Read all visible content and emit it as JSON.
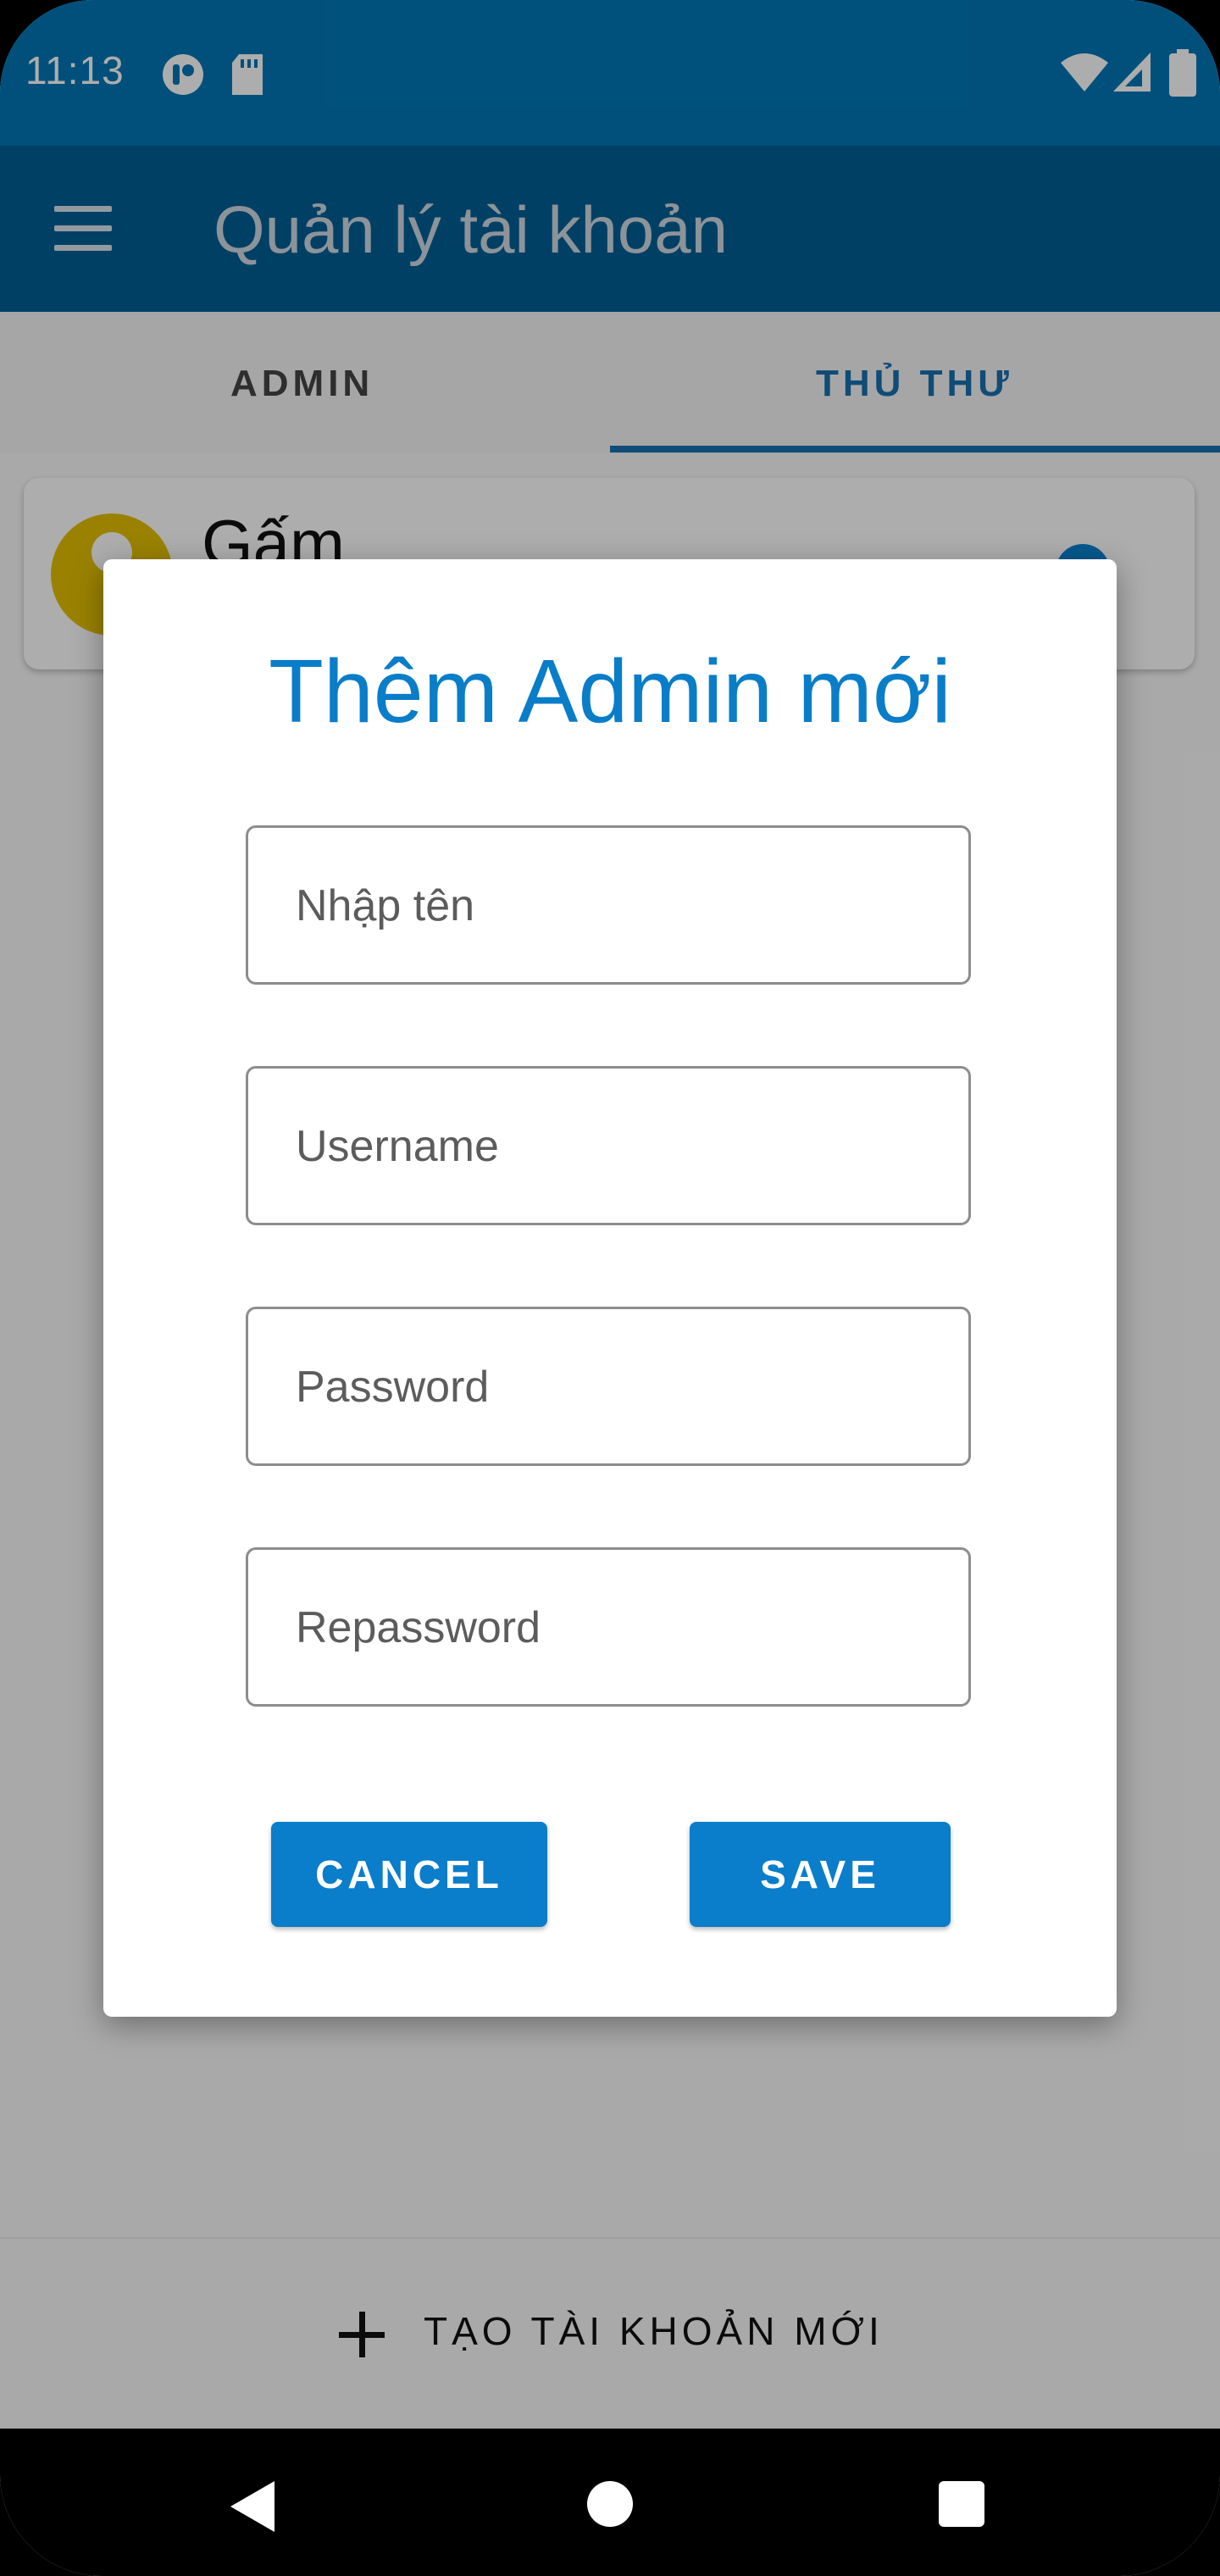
{
  "status_bar": {
    "time": "11:13",
    "icons": [
      "media-icon",
      "sd-card-icon",
      "wifi-icon",
      "signal-icon",
      "battery-icon"
    ]
  },
  "app_bar": {
    "title": "Quản lý tài khoản",
    "menu_icon": "hamburger-menu-icon"
  },
  "tabs": [
    {
      "label": "ADMIN",
      "selected": false
    },
    {
      "label": "THỦ THƯ",
      "selected": true
    }
  ],
  "list": {
    "items": [
      {
        "name": "Gấm"
      }
    ]
  },
  "dialog": {
    "title": "Thêm Admin mới",
    "fields": {
      "name": {
        "placeholder": "Nhập tên",
        "value": ""
      },
      "username": {
        "placeholder": "Username",
        "value": ""
      },
      "password": {
        "placeholder": "Password",
        "value": ""
      },
      "repassword": {
        "placeholder": "Repassword",
        "value": ""
      }
    },
    "cancel_label": "CANCEL",
    "save_label": "SAVE"
  },
  "bottom_action": {
    "label": "TẠO TÀI KHOẢN MỚI",
    "icon": "plus-icon"
  },
  "colors": {
    "status_bar": "#0077b5",
    "app_bar": "#005f96",
    "accent": "#0a7dc8",
    "avatar": "#e4c000"
  }
}
